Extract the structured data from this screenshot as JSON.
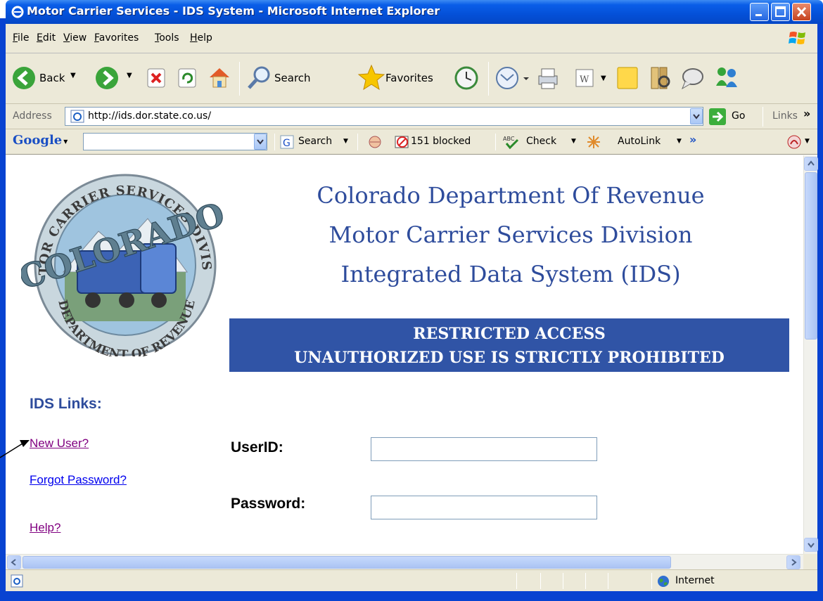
{
  "window": {
    "title": "Motor Carrier Services - IDS System - Microsoft Internet Explorer"
  },
  "menu": [
    "File",
    "Edit",
    "View",
    "Favorites",
    "Tools",
    "Help"
  ],
  "toolbar": {
    "back_label": "Back",
    "search_label": "Search",
    "favorites_label": "Favorites"
  },
  "address": {
    "label": "Address",
    "url": "http://ids.dor.state.co.us/",
    "go_label": "Go",
    "links_label": "Links"
  },
  "googlebar": {
    "logo": "Google",
    "search_label": "Search",
    "blocked_label": "151 blocked",
    "check_label": "Check",
    "autolink_label": "AutoLink"
  },
  "header": {
    "line1": "Colorado Department Of Revenue",
    "line2": "Motor Carrier Services Division",
    "line3": "Integrated Data System (IDS)"
  },
  "banner": {
    "line1": "RESTRICTED ACCESS",
    "line2": "UNAUTHORIZED USE IS STRICTLY PROHIBITED"
  },
  "seal": {
    "top_text": "MOTOR CARRIER SERVICES DIVISION",
    "center_text": "COLORADO",
    "bottom_text": "DEPARTMENT OF REVENUE"
  },
  "links": {
    "heading": "IDS Links:",
    "new_user": "New User?",
    "forgot_password": "Forgot Password?",
    "help": "Help?"
  },
  "login": {
    "userid_label": "UserID:",
    "userid_value": "",
    "password_label": "Password:",
    "password_value": ""
  },
  "status": {
    "zone": "Internet"
  },
  "colors": {
    "heading": "#2e4c9c",
    "banner_bg": "#3054a6",
    "titlebar": "#0450d8",
    "chrome": "#ece9d8",
    "visited_link": "#800080",
    "link": "#0000ee"
  }
}
